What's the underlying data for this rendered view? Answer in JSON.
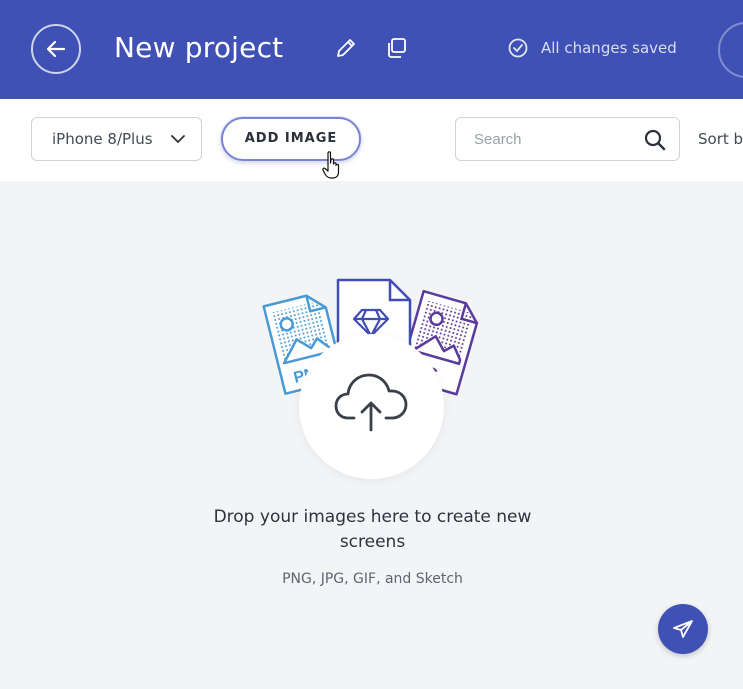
{
  "header": {
    "title": "New project",
    "status": "All changes saved",
    "color": "#3f51b5"
  },
  "toolbar": {
    "device_select": "iPhone 8/Plus",
    "add_image_label": "ADD IMAGE",
    "search_placeholder": "Search",
    "sort_label": "Sort b"
  },
  "empty_state": {
    "message": "Drop your images here to create new screens",
    "formats": "PNG, JPG, GIF, and Sketch"
  },
  "icons": {
    "back": "arrow-left-icon",
    "edit": "pencil-icon",
    "duplicate": "copy-icon",
    "saved": "check-circle-icon",
    "upload": "cloud-upload-icon",
    "send": "paper-plane-icon"
  }
}
